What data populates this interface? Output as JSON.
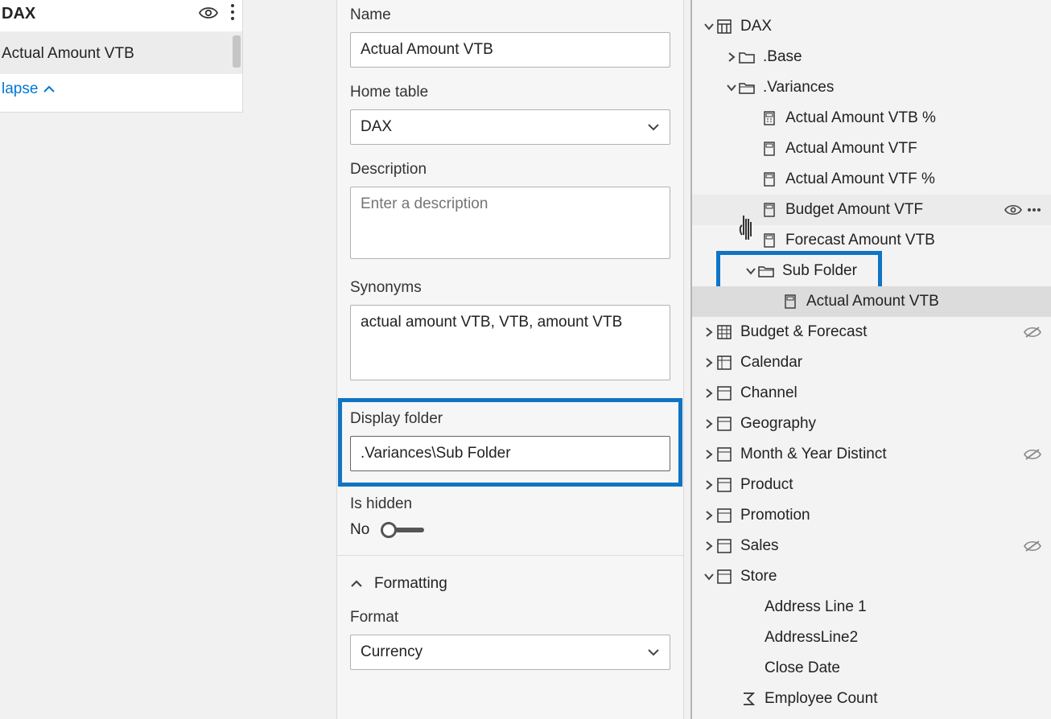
{
  "left": {
    "title": "DAX",
    "measure": "Actual Amount VTB",
    "collapse": "lapse"
  },
  "props": {
    "name_label": "Name",
    "name_value": "Actual Amount VTB",
    "home_table_label": "Home table",
    "home_table_value": "DAX",
    "description_label": "Description",
    "description_placeholder": "Enter a description",
    "synonyms_label": "Synonyms",
    "synonyms_value": "actual amount VTB, VTB, amount VTB",
    "display_folder_label": "Display folder",
    "display_folder_value": ".Variances\\Sub Folder",
    "is_hidden_label": "Is hidden",
    "is_hidden_value": "No",
    "formatting_header": "Formatting",
    "format_label": "Format",
    "format_value": "Currency"
  },
  "tree": {
    "dax": "DAX",
    "base": ".Base",
    "variances": ".Variances",
    "m1": "Actual Amount VTB %",
    "m2": "Actual Amount VTF",
    "m3": "Actual Amount VTF %",
    "m4": "Budget Amount VTF",
    "m5": "Forecast Amount VTB",
    "subfolder": "Sub Folder",
    "m6": "Actual Amount VTB",
    "t1": "Budget & Forecast",
    "t2": "Calendar",
    "t3": "Channel",
    "t4": "Geography",
    "t5": "Month & Year Distinct",
    "t6": "Product",
    "t7": "Promotion",
    "t8": "Sales",
    "t9": "Store",
    "s1": "Address Line 1",
    "s2": "AddressLine2",
    "s3": "Close Date",
    "s4": "Employee Count"
  }
}
